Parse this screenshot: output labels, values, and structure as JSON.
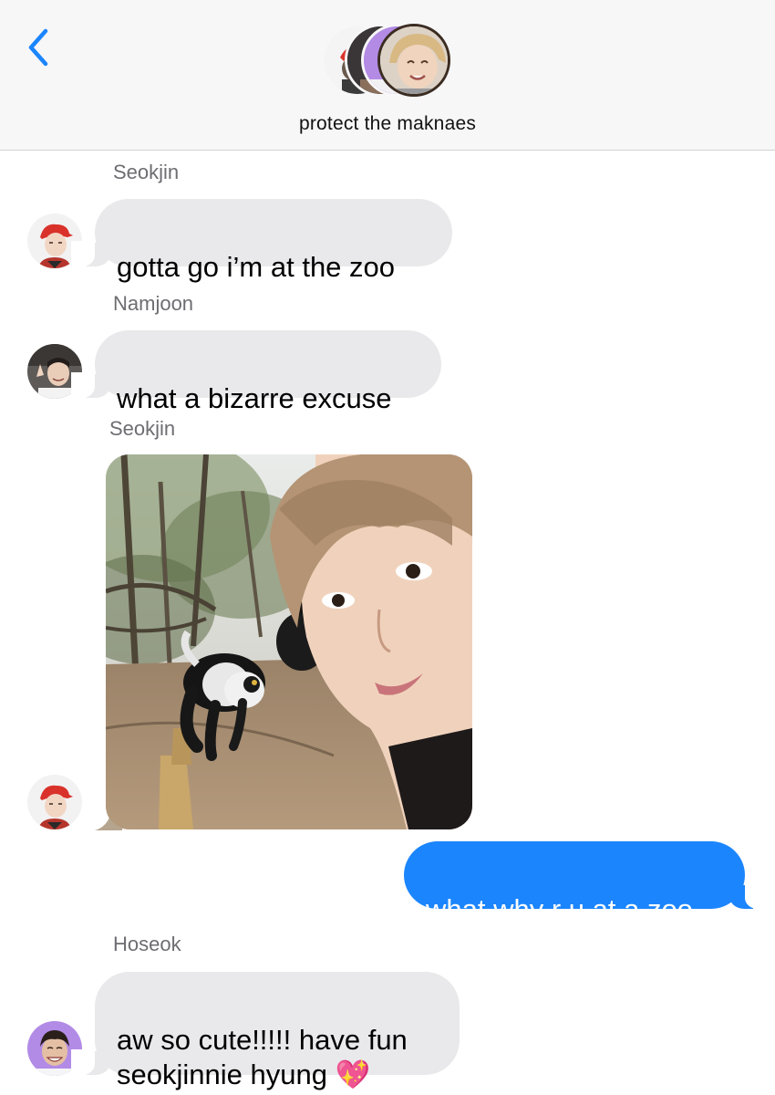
{
  "header": {
    "title": "protect the maknaes",
    "back_icon": "chevron-left-icon",
    "accent_color": "#1b85fd"
  },
  "messages": [
    {
      "sender": "Seokjin",
      "text": "gotta go i’m at the zoo",
      "direction": "incoming",
      "avatar": "seokjin-avatar"
    },
    {
      "sender": "Namjoon",
      "text": "what a bizarre excuse",
      "direction": "incoming",
      "avatar": "namjoon-avatar"
    },
    {
      "sender": "Seokjin",
      "type": "photo",
      "photo": "selfie with black-and-white lemur in forest",
      "direction": "incoming",
      "avatar": "seokjin-avatar"
    },
    {
      "text": "what why r u at a zoo",
      "direction": "outgoing"
    },
    {
      "sender": "Hoseok",
      "text": "aw so cute!!!!! have fun\nseokjinnie hyung 💖",
      "direction": "incoming",
      "avatar": "hoseok-avatar"
    }
  ],
  "colors": {
    "incoming_bubble": "#e9e9eb",
    "outgoing_bubble": "#1b85fd",
    "sender_name": "#6d6d72"
  }
}
